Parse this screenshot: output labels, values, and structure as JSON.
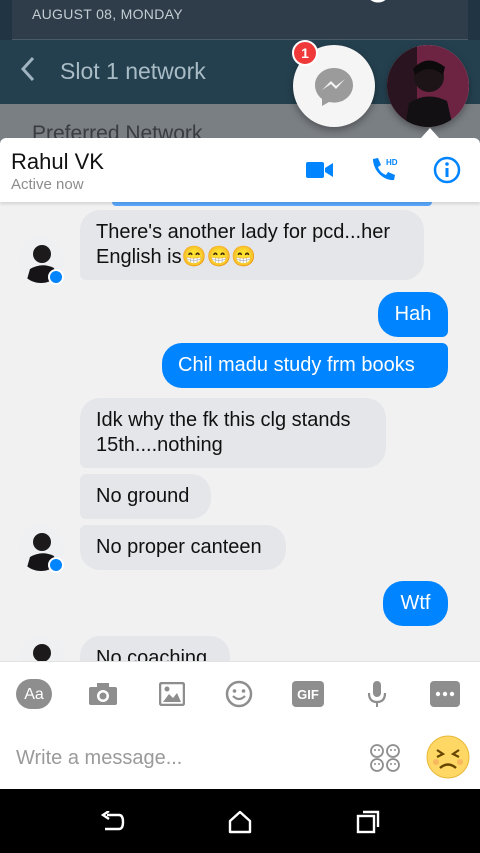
{
  "background_app": {
    "date": "AUGUST 08, MONDAY",
    "screen_title": "Slot 1 network",
    "next_item": "Preferred Network"
  },
  "chat_heads": {
    "unread_count": "1"
  },
  "conversation": {
    "name": "Rahul VK",
    "status": "Active now",
    "hd_label": "HD"
  },
  "messages": [
    {
      "sender": "them",
      "text": "There's another lady for pcd...her English is😁😁😁"
    },
    {
      "sender": "me",
      "text": "Hah"
    },
    {
      "sender": "me",
      "text": "Chil madu study frm books"
    },
    {
      "sender": "them",
      "text": "Idk why the fk this clg stands 15th....nothing"
    },
    {
      "sender": "them",
      "text": "No ground"
    },
    {
      "sender": "them",
      "text": "No proper canteen"
    },
    {
      "sender": "me",
      "text": "Wtf"
    },
    {
      "sender": "them",
      "text": "No coaching"
    }
  ],
  "toolbar": {
    "text_label": "Aa",
    "gif_label": "GIF"
  },
  "composer": {
    "placeholder": "Write a message..."
  },
  "colors": {
    "messenger_blue": "#0084ff",
    "incoming_bubble": "#e4e6ea",
    "badge_red": "#f03a3a"
  }
}
